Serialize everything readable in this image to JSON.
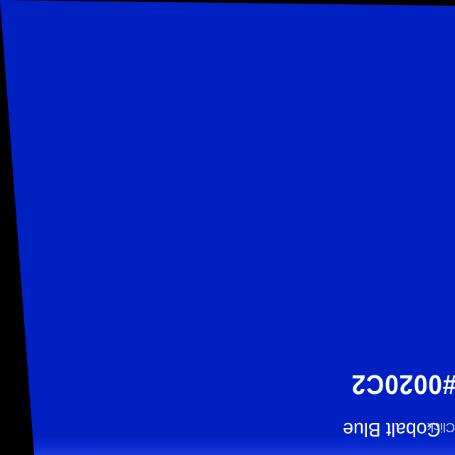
{
  "swatch": {
    "background_color": "#0020C2",
    "name": "Cobalt Blue",
    "hex": "#0020C2",
    "hint": "Click"
  }
}
